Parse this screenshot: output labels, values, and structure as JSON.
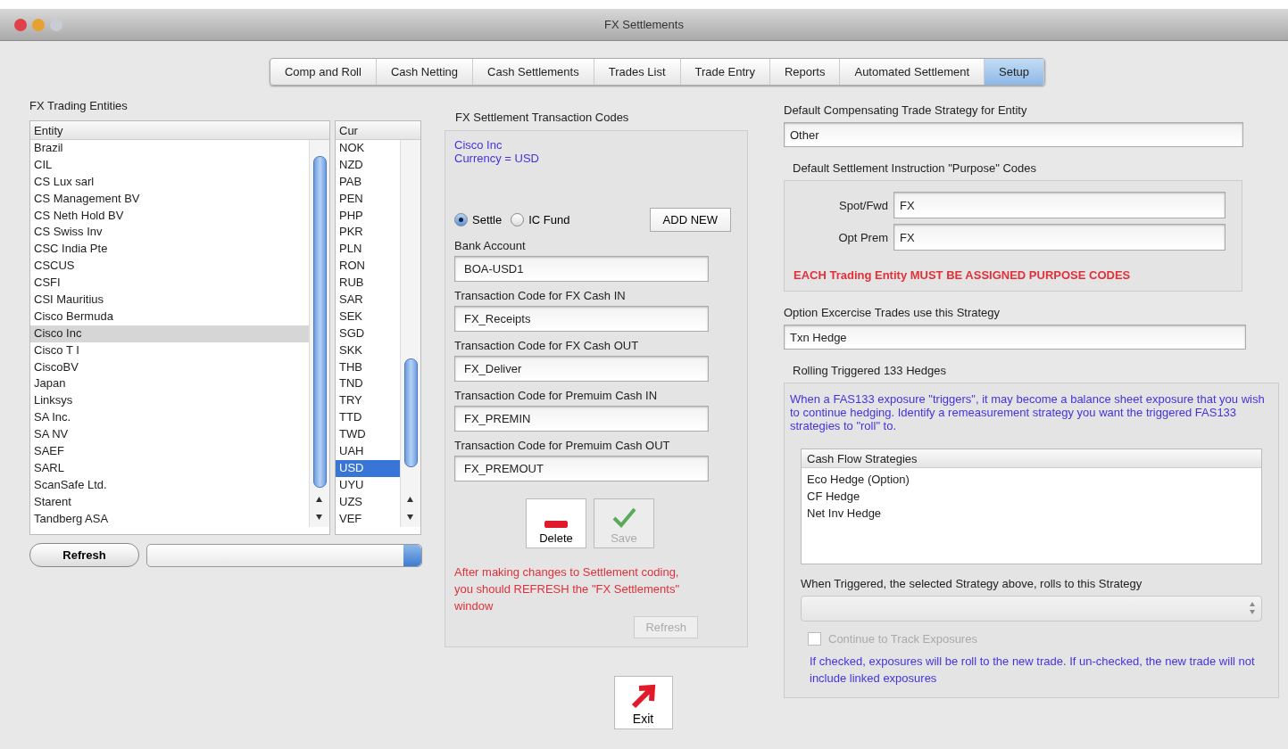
{
  "window": {
    "title": "FX Settlements"
  },
  "tabs": [
    {
      "label": "Comp and Roll",
      "selected": false
    },
    {
      "label": "Cash Netting",
      "selected": false
    },
    {
      "label": "Cash Settlements",
      "selected": false
    },
    {
      "label": "Trades List",
      "selected": false
    },
    {
      "label": "Trade Entry",
      "selected": false
    },
    {
      "label": "Reports",
      "selected": false
    },
    {
      "label": "Automated Settlement",
      "selected": false
    },
    {
      "label": "Setup",
      "selected": true
    }
  ],
  "entities_panel": {
    "title": "FX Trading Entities",
    "columns": [
      "Entity",
      "Cur"
    ],
    "entities": [
      {
        "name": "Brazil",
        "selected": false
      },
      {
        "name": "CIL",
        "selected": false
      },
      {
        "name": "CS Lux sarl",
        "selected": false
      },
      {
        "name": "CS Management BV",
        "selected": false
      },
      {
        "name": "CS Neth Hold BV",
        "selected": false
      },
      {
        "name": "CS Swiss Inv",
        "selected": false
      },
      {
        "name": "CSC India Pte",
        "selected": false
      },
      {
        "name": "CSCUS",
        "selected": false
      },
      {
        "name": "CSFI",
        "selected": false
      },
      {
        "name": "CSI Mauritius",
        "selected": false
      },
      {
        "name": "Cisco Bermuda",
        "selected": false
      },
      {
        "name": "Cisco Inc",
        "selected": true
      },
      {
        "name": "Cisco T I",
        "selected": false
      },
      {
        "name": "CiscoBV",
        "selected": false
      },
      {
        "name": "Japan",
        "selected": false
      },
      {
        "name": "Linksys",
        "selected": false
      },
      {
        "name": "SA Inc.",
        "selected": false
      },
      {
        "name": "SA NV",
        "selected": false
      },
      {
        "name": "SAEF",
        "selected": false
      },
      {
        "name": "SARL",
        "selected": false
      },
      {
        "name": "ScanSafe Ltd.",
        "selected": false
      },
      {
        "name": "Starent",
        "selected": false
      },
      {
        "name": "Tandberg ASA",
        "selected": false
      }
    ],
    "currencies": [
      {
        "code": "NOK",
        "selected": false
      },
      {
        "code": "NZD",
        "selected": false
      },
      {
        "code": "PAB",
        "selected": false
      },
      {
        "code": "PEN",
        "selected": false
      },
      {
        "code": "PHP",
        "selected": false
      },
      {
        "code": "PKR",
        "selected": false
      },
      {
        "code": "PLN",
        "selected": false
      },
      {
        "code": "RON",
        "selected": false
      },
      {
        "code": "RUB",
        "selected": false
      },
      {
        "code": "SAR",
        "selected": false
      },
      {
        "code": "SEK",
        "selected": false
      },
      {
        "code": "SGD",
        "selected": false
      },
      {
        "code": "SKK",
        "selected": false
      },
      {
        "code": "THB",
        "selected": false
      },
      {
        "code": "TND",
        "selected": false
      },
      {
        "code": "TRY",
        "selected": false
      },
      {
        "code": "TTD",
        "selected": false
      },
      {
        "code": "TWD",
        "selected": false
      },
      {
        "code": "UAH",
        "selected": false
      },
      {
        "code": "USD",
        "selected": true
      },
      {
        "code": "UYU",
        "selected": false
      },
      {
        "code": "UZS",
        "selected": false
      },
      {
        "code": "VEF",
        "selected": false
      }
    ],
    "refresh_button": "Refresh"
  },
  "codes_panel": {
    "title": "FX Settlement Transaction Codes",
    "info": [
      "Cisco Inc",
      "Currency = USD"
    ],
    "radios": [
      {
        "label": "Settle",
        "selected": true
      },
      {
        "label": "IC Fund",
        "selected": false
      }
    ],
    "add_button": "ADD NEW",
    "fields": [
      {
        "label": "Bank Account",
        "value": "BOA-USD1"
      },
      {
        "label": "Transaction Code for FX Cash IN",
        "value": "FX_Receipts"
      },
      {
        "label": "Transaction Code for FX Cash OUT",
        "value": "FX_Deliver"
      },
      {
        "label": "Transaction Code for Premuim Cash IN",
        "value": "FX_PREMIN"
      },
      {
        "label": "Transaction Code for Premuim Cash OUT",
        "value": "FX_PREMOUT"
      }
    ],
    "actions": [
      {
        "kind": "delete",
        "label": "Delete",
        "disabled": false
      },
      {
        "kind": "save",
        "label": "Save",
        "disabled": true
      }
    ],
    "note": "After making changes to Settlement coding, you should REFRESH the \"FX Settlements\" window",
    "refresh": {
      "label": "Refresh",
      "disabled": true
    },
    "exit_button": "Exit"
  },
  "strategy_panel": {
    "default_label": "Default Compensating Trade Strategy for Entity",
    "default_value": "Other",
    "purpose_title": "Default Settlement Instruction \"Purpose\" Codes",
    "purpose_fields": [
      {
        "label": "Spot/Fwd",
        "value": "FX"
      },
      {
        "label": "Opt Prem",
        "value": "FX"
      }
    ],
    "warning": "EACH Trading Entity MUST BE ASSIGNED PURPOSE CODES",
    "option_label": "Option Excercise Trades use this Strategy",
    "option_value": "Txn Hedge",
    "rolling_title": "Rolling Triggered 133 Hedges",
    "rolling_info": "When a FAS133 exposure \"triggers\", it may become a balance sheet exposure that you wish to continue hedging. Identify a remeasurement strategy you want the triggered FAS133 strategies to \"roll\" to.",
    "strategies_header": "Cash Flow Strategies",
    "strategies": [
      "Eco Hedge (Option)",
      "CF Hedge",
      "Net Inv Hedge"
    ],
    "rolls_label": "When Triggered, the selected Strategy above, rolls to this Strategy",
    "rolls_select": {
      "disabled": true
    },
    "track_checkbox": {
      "label": "Continue to Track Exposures",
      "checked": false,
      "disabled": true
    },
    "track_note": "If checked, exposures will be roll to the new trade. If un-checked, the new trade will not include linked exposures"
  }
}
